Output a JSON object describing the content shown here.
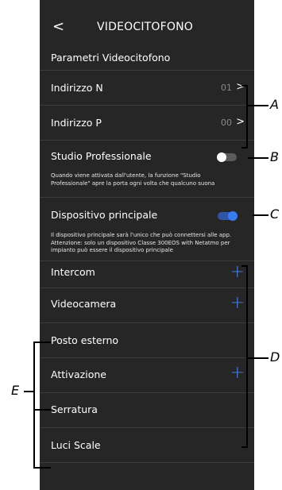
{
  "header": {
    "back_icon": "chevron-left-icon",
    "back_glyph": "<",
    "title": "VIDEOCITOFONO"
  },
  "section_title": "Parametri Videocitofono",
  "address_rows": [
    {
      "label": "Indirizzo N",
      "value": "01",
      "chevron": ">"
    },
    {
      "label": "Indirizzo P",
      "value": "00",
      "chevron": ">"
    }
  ],
  "studio": {
    "label": "Studio Professionale",
    "toggle_on": false,
    "description": "Quando viene attivata dall'utente, la funzione \"Studio Professionale\" apre la porta ogni volta che qualcuno suona"
  },
  "main_device": {
    "label": "Dispositivo principale",
    "toggle_on": true,
    "description": "Il dispositivo principale sarà l'unico che può connettersi alle app. Attenzione: solo un dispositivo Classe 300EOS with Netatmo per impianto può essere il dispositivo principale"
  },
  "list_items": [
    {
      "label": "Intercom",
      "has_add": true,
      "add_glyph": "+"
    },
    {
      "label": "Videocamera",
      "has_add": true,
      "add_glyph": "+"
    },
    {
      "label": "Posto esterno",
      "has_add": false
    },
    {
      "label": "Attivazione",
      "has_add": true,
      "add_glyph": "+"
    },
    {
      "label": "Serratura",
      "has_add": false
    },
    {
      "label": "Luci Scale",
      "has_add": false
    }
  ],
  "callouts": {
    "A": "A",
    "B": "B",
    "C": "C",
    "D": "D",
    "E": "E"
  },
  "colors": {
    "background": "#262626",
    "accent": "#3b7bf0",
    "divider": "#3c3c3c",
    "muted": "#8a8a8a"
  }
}
